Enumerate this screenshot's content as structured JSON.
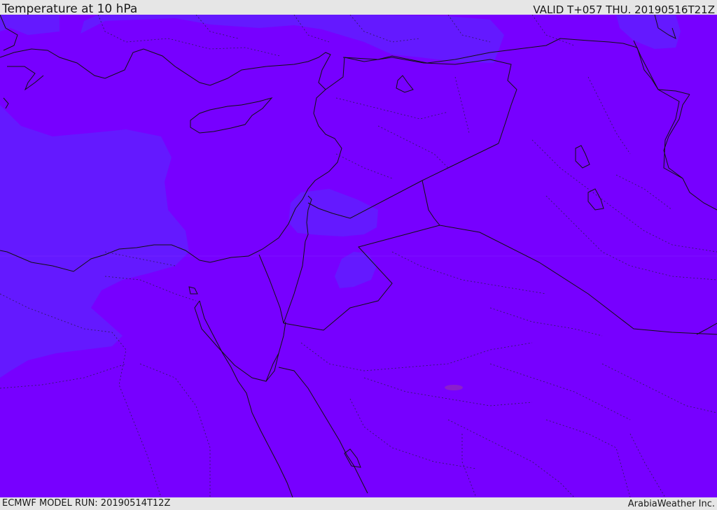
{
  "header": {
    "title": "Temperature at 10 hPa",
    "valid_time": "VALID T+057 THU. 20190516T21Z"
  },
  "footer": {
    "model_run": "ECMWF MODEL RUN: 20190514T12Z",
    "credit": "ArabiaWeather Inc."
  },
  "map": {
    "field_colors": {
      "base": "#7700ff",
      "cooler_band": "#6419ff",
      "warm_spot": "#8a1fcc"
    },
    "line_color": "#111111"
  }
}
